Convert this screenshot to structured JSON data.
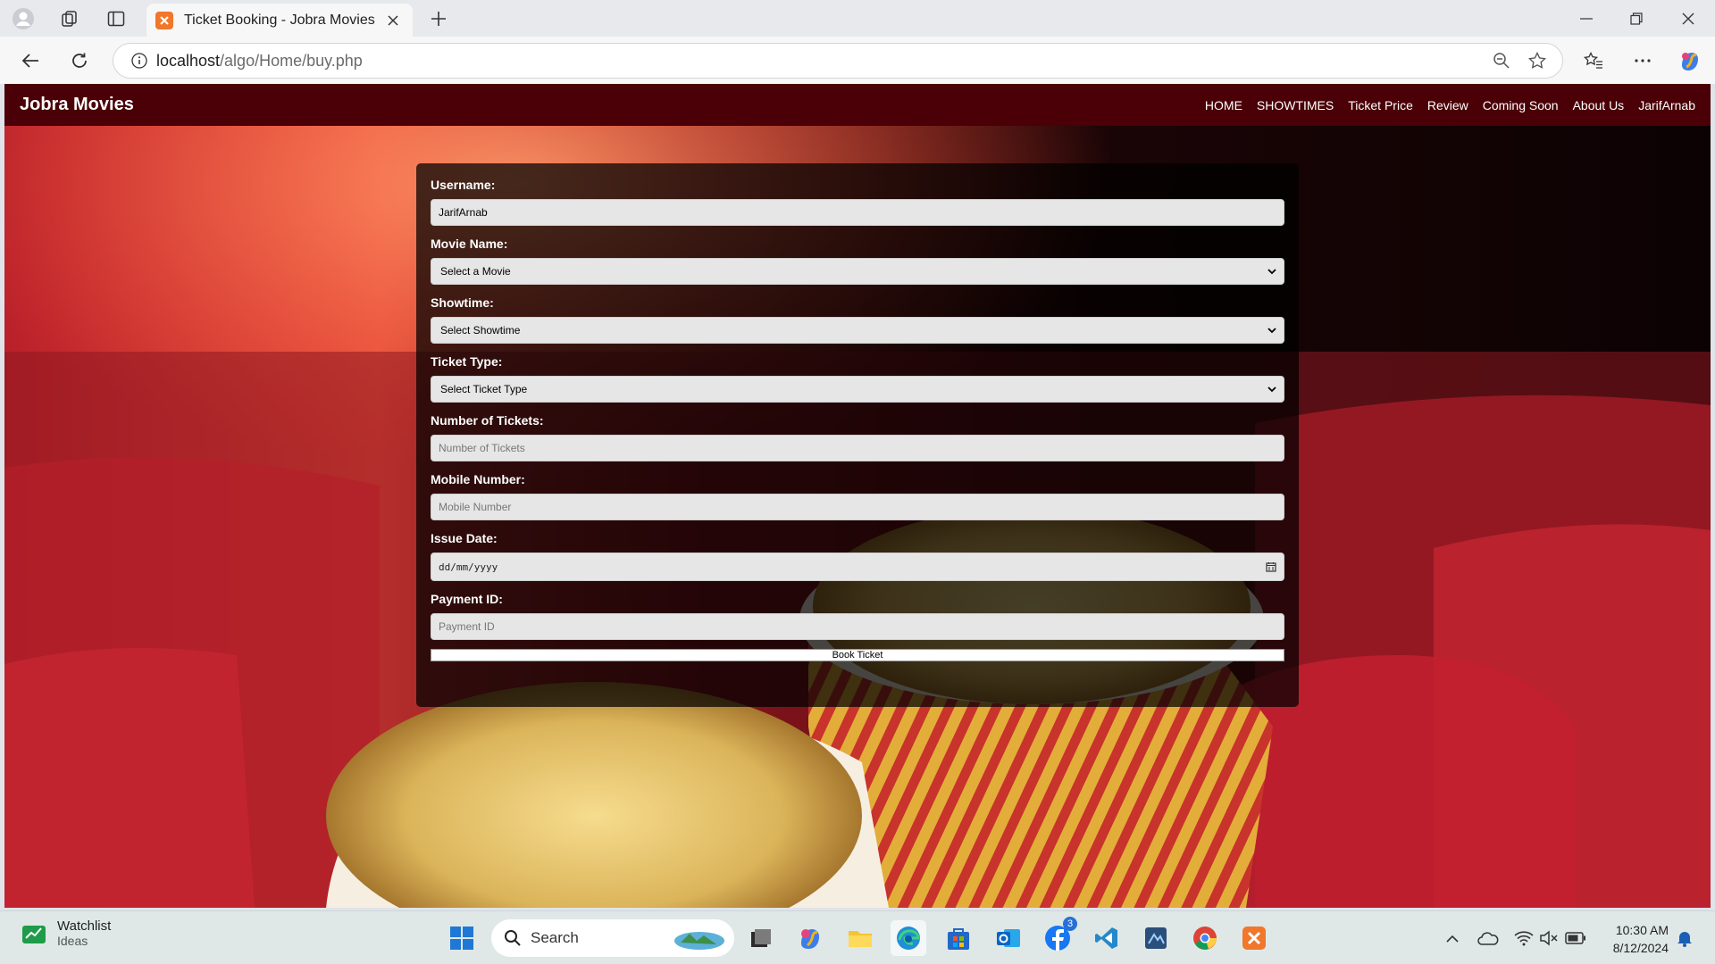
{
  "browser": {
    "tab_title": "Ticket Booking - Jobra Movies",
    "url_host": "localhost",
    "url_path": "/algo/Home/buy.php"
  },
  "site": {
    "brand": "Jobra Movies",
    "nav": [
      "HOME",
      "SHOWTIMES",
      "Ticket Price",
      "Review",
      "Coming Soon",
      "About Us",
      "JarifArnab"
    ]
  },
  "form": {
    "username_label": "Username:",
    "username_value": "JarifArnab",
    "movie_label": "Movie Name:",
    "movie_selected": "Select a Movie",
    "showtime_label": "Showtime:",
    "showtime_selected": "Select Showtime",
    "ticket_type_label": "Ticket Type:",
    "ticket_type_selected": "Select Ticket Type",
    "tickets_label": "Number of Tickets:",
    "tickets_placeholder": "Number of Tickets",
    "mobile_label": "Mobile Number:",
    "mobile_placeholder": "Mobile Number",
    "date_label": "Issue Date:",
    "date_placeholder": "dd/mm/yyyy",
    "payment_label": "Payment ID:",
    "payment_placeholder": "Payment ID",
    "submit_label": "Book Ticket"
  },
  "taskbar": {
    "widget_title": "Watchlist",
    "widget_subtitle": "Ideas",
    "search_label": "Search",
    "facebook_badge": "3",
    "time": "10:30 AM",
    "date": "8/12/2024"
  }
}
